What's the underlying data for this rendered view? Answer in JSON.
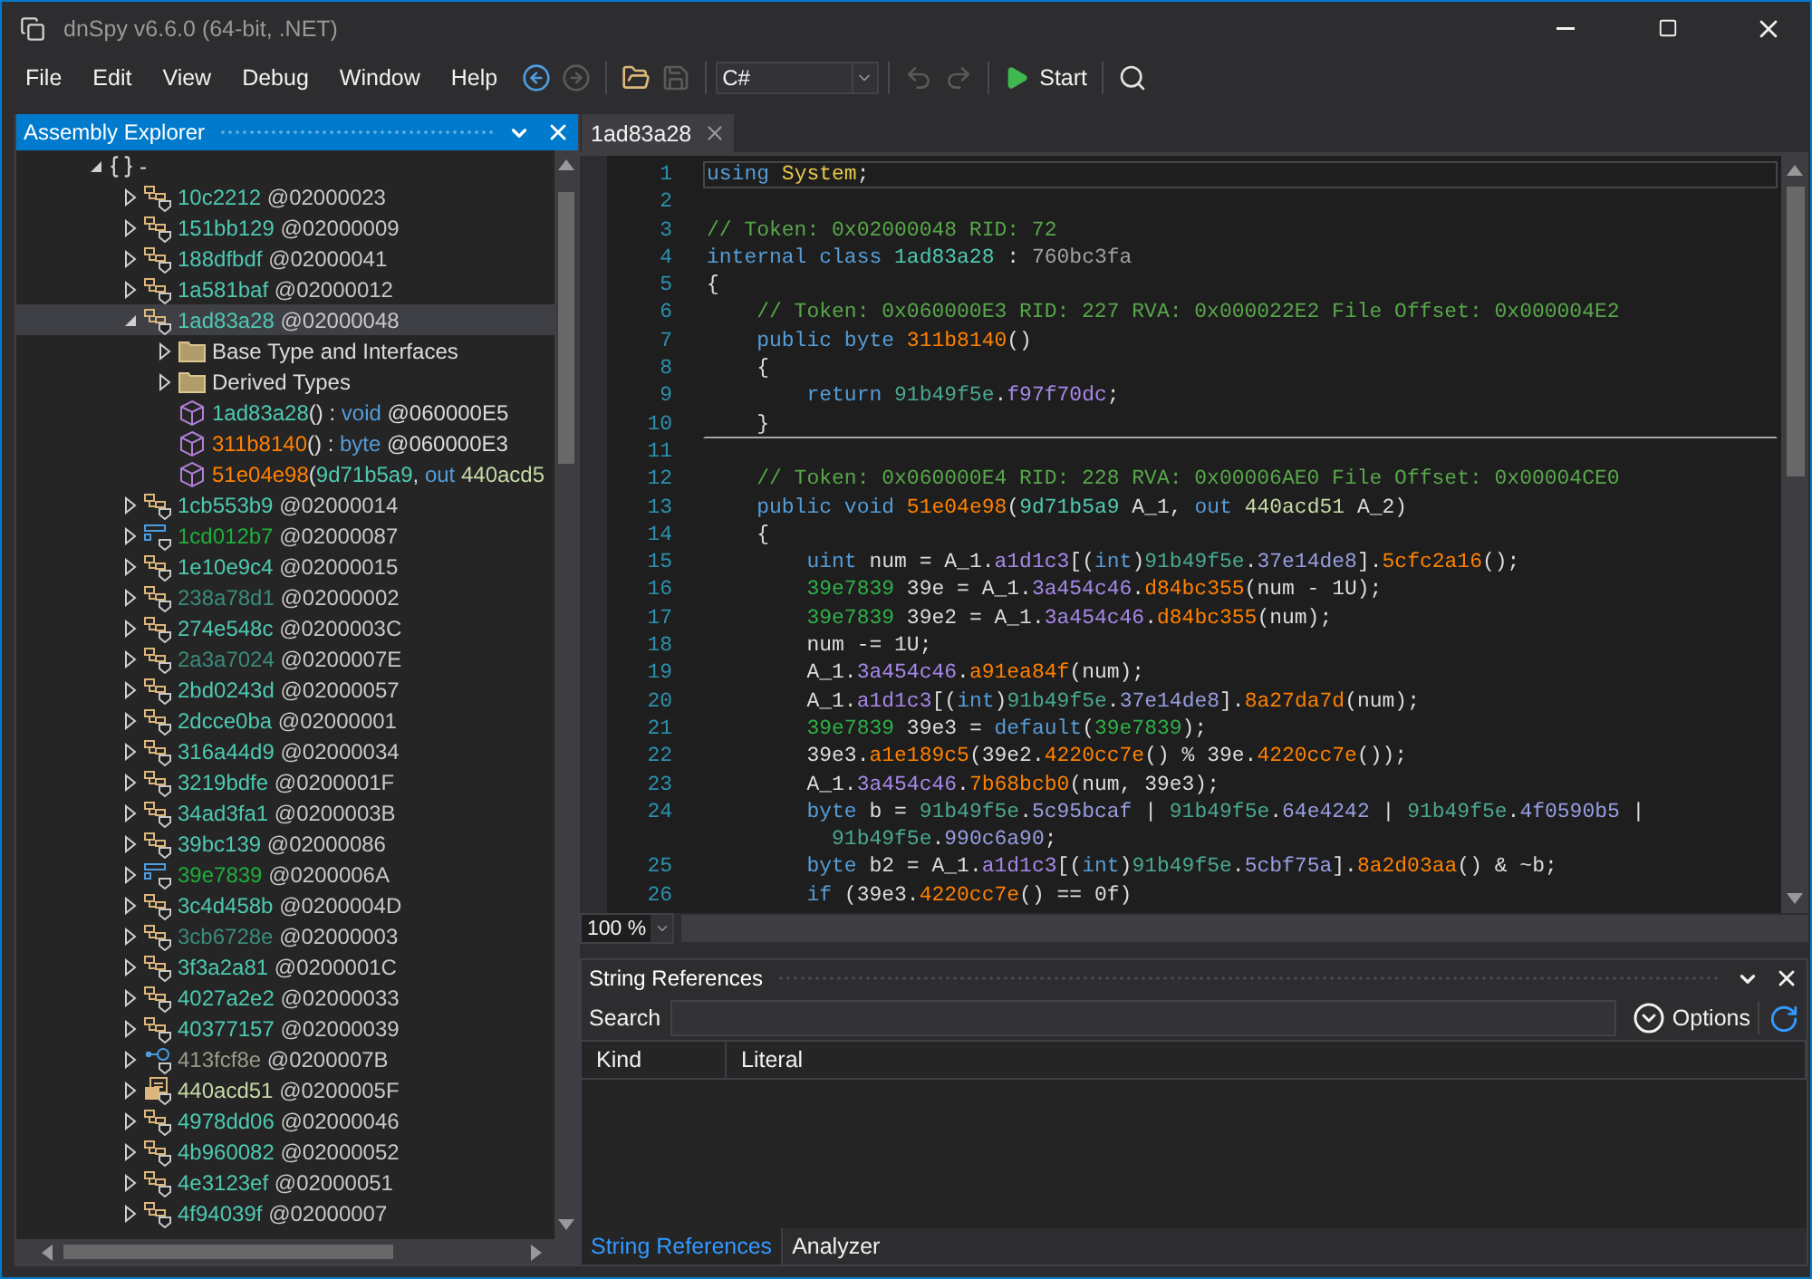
{
  "window": {
    "title": "dnSpy v6.6.0 (64-bit, .NET)"
  },
  "menu": [
    "File",
    "Edit",
    "View",
    "Debug",
    "Window",
    "Help"
  ],
  "toolbar": [
    {
      "kind": "back",
      "disabled": false
    },
    {
      "kind": "forward",
      "disabled": true
    },
    {
      "kind": "separator"
    },
    {
      "kind": "open",
      "disabled": false
    },
    {
      "kind": "save",
      "disabled": true
    },
    {
      "kind": "separator"
    },
    {
      "kind": "language",
      "value": "C#"
    },
    {
      "kind": "separator"
    },
    {
      "kind": "undo",
      "disabled": true
    },
    {
      "kind": "redo",
      "disabled": true
    },
    {
      "kind": "separator"
    },
    {
      "kind": "start",
      "label": "Start",
      "disabled": false
    },
    {
      "kind": "separator"
    },
    {
      "kind": "search",
      "disabled": false
    }
  ],
  "assembly_explorer": {
    "title": "Assembly Explorer",
    "tree": [
      {
        "kind": "namespace",
        "label": "-",
        "expanded": true,
        "selected": false,
        "children": [
          {
            "kind": "class",
            "name": "10c2212",
            "token": "@02000023",
            "dimmed": false,
            "expanded": false,
            "selected": false
          },
          {
            "kind": "class",
            "name": "151bb129",
            "token": "@02000009",
            "dimmed": false,
            "expanded": false,
            "selected": false
          },
          {
            "kind": "class",
            "name": "188dfbdf",
            "token": "@02000041",
            "dimmed": false,
            "expanded": false,
            "selected": false
          },
          {
            "kind": "class",
            "name": "1a581baf",
            "token": "@02000012",
            "dimmed": false,
            "expanded": false,
            "selected": false
          },
          {
            "kind": "class",
            "name": "1ad83a28",
            "token": "@02000048",
            "dimmed": false,
            "expanded": true,
            "selected": true,
            "children": [
              {
                "kind": "folder",
                "label": "Base Type and Interfaces",
                "expanded": false,
                "selected": false
              },
              {
                "kind": "folder",
                "label": "Derived Types",
                "expanded": false,
                "selected": false
              },
              {
                "kind": "method",
                "selected": false,
                "signature": [
                  {
                    "kind": "type",
                    "text": "1ad83a28"
                  },
                  {
                    "kind": "plain",
                    "text": "() : "
                  },
                  {
                    "kind": "keyword",
                    "text": "void"
                  },
                  {
                    "kind": "plain",
                    "text": " @060000E5"
                  }
                ]
              },
              {
                "kind": "method",
                "selected": false,
                "signature": [
                  {
                    "kind": "method",
                    "text": "311b8140"
                  },
                  {
                    "kind": "plain",
                    "text": "() : "
                  },
                  {
                    "kind": "keyword",
                    "text": "byte"
                  },
                  {
                    "kind": "plain",
                    "text": " @060000E3"
                  }
                ]
              },
              {
                "kind": "method",
                "selected": false,
                "signature": [
                  {
                    "kind": "method",
                    "text": "51e04e98"
                  },
                  {
                    "kind": "plain",
                    "text": "("
                  },
                  {
                    "kind": "type",
                    "text": "9d71b5a9"
                  },
                  {
                    "kind": "plain",
                    "text": ", "
                  },
                  {
                    "kind": "keyword",
                    "text": "out"
                  },
                  {
                    "kind": "delegate",
                    "text": " 440acd5"
                  }
                ]
              }
            ]
          },
          {
            "kind": "class",
            "name": "1cb553b9",
            "token": "@02000014",
            "dimmed": false,
            "expanded": false,
            "selected": false
          },
          {
            "kind": "struct",
            "name": "1cd012b7",
            "token": "@02000087",
            "dimmed": false,
            "expanded": false,
            "selected": false
          },
          {
            "kind": "class",
            "name": "1e10e9c4",
            "token": "@02000015",
            "dimmed": false,
            "expanded": false,
            "selected": false
          },
          {
            "kind": "class",
            "name": "238a78d1",
            "token": "@02000002",
            "dimmed": true,
            "expanded": false,
            "selected": false
          },
          {
            "kind": "class",
            "name": "274e548c",
            "token": "@0200003C",
            "dimmed": false,
            "expanded": false,
            "selected": false
          },
          {
            "kind": "class",
            "name": "2a3a7024",
            "token": "@0200007E",
            "dimmed": true,
            "expanded": false,
            "selected": false
          },
          {
            "kind": "class",
            "name": "2bd0243d",
            "token": "@02000057",
            "dimmed": false,
            "expanded": false,
            "selected": false
          },
          {
            "kind": "class",
            "name": "2dcce0ba",
            "token": "@02000001",
            "dimmed": false,
            "expanded": false,
            "selected": false
          },
          {
            "kind": "class",
            "name": "316a44d9",
            "token": "@02000034",
            "dimmed": false,
            "expanded": false,
            "selected": false
          },
          {
            "kind": "class",
            "name": "3219bdfe",
            "token": "@0200001F",
            "dimmed": false,
            "expanded": false,
            "selected": false
          },
          {
            "kind": "class",
            "name": "34ad3fa1",
            "token": "@0200003B",
            "dimmed": false,
            "expanded": false,
            "selected": false
          },
          {
            "kind": "class",
            "name": "39bc139",
            "token": "@02000086",
            "dimmed": false,
            "expanded": false,
            "selected": false
          },
          {
            "kind": "struct",
            "name": "39e7839",
            "token": "@0200006A",
            "dimmed": false,
            "expanded": false,
            "selected": false
          },
          {
            "kind": "class",
            "name": "3c4d458b",
            "token": "@0200004D",
            "dimmed": false,
            "expanded": false,
            "selected": false
          },
          {
            "kind": "class",
            "name": "3cb6728e",
            "token": "@02000003",
            "dimmed": true,
            "expanded": false,
            "selected": false
          },
          {
            "kind": "class",
            "name": "3f3a2a81",
            "token": "@0200001C",
            "dimmed": false,
            "expanded": false,
            "selected": false
          },
          {
            "kind": "class",
            "name": "4027a2e2",
            "token": "@02000033",
            "dimmed": false,
            "expanded": false,
            "selected": false
          },
          {
            "kind": "class",
            "name": "40377157",
            "token": "@02000039",
            "dimmed": false,
            "expanded": false,
            "selected": false
          },
          {
            "kind": "interface",
            "name": "413fcf8e",
            "token": "@0200007B",
            "dimmed": false,
            "expanded": false,
            "selected": false
          },
          {
            "kind": "delegate",
            "name": "440acd51",
            "token": "@0200005F",
            "dimmed": false,
            "expanded": false,
            "selected": false
          },
          {
            "kind": "class",
            "name": "4978dd06",
            "token": "@02000046",
            "dimmed": false,
            "expanded": false,
            "selected": false
          },
          {
            "kind": "class",
            "name": "4b960082",
            "token": "@02000052",
            "dimmed": false,
            "expanded": false,
            "selected": false
          },
          {
            "kind": "class",
            "name": "4e3123ef",
            "token": "@02000051",
            "dimmed": false,
            "expanded": false,
            "selected": false
          },
          {
            "kind": "class",
            "name": "4f94039f",
            "token": "@02000007",
            "dimmed": false,
            "expanded": false,
            "selected": false
          }
        ]
      }
    ]
  },
  "editor": {
    "tabs": [
      {
        "label": "1ad83a28",
        "selected": true
      }
    ],
    "lines": [
      {
        "number": "1",
        "current": true,
        "separator_below": false,
        "tokens": [
          {
            "kind": "keyword",
            "text": "using"
          },
          {
            "kind": "namespace",
            "text": " System"
          },
          {
            "kind": "plain",
            "text": ";"
          }
        ]
      },
      {
        "number": "2",
        "current": false,
        "separator_below": false
      },
      {
        "number": "3",
        "current": false,
        "separator_below": false,
        "tokens": [
          {
            "kind": "comment",
            "text": "// Token: 0x02000048 RID: 72"
          }
        ]
      },
      {
        "number": "4",
        "current": false,
        "separator_below": false,
        "tokens": [
          {
            "kind": "keyword",
            "text": "internal class"
          },
          {
            "kind": "type",
            "text": " 1ad83a28"
          },
          {
            "kind": "plain",
            "text": " : "
          },
          {
            "kind": "basetype",
            "text": "760bc3fa"
          }
        ]
      },
      {
        "number": "5",
        "current": false,
        "separator_below": false,
        "tokens": [
          {
            "kind": "plain",
            "text": "{"
          }
        ]
      },
      {
        "number": "6",
        "current": false,
        "separator_below": false,
        "tokens": [
          {
            "kind": "comment",
            "text": "    // Token: 0x060000E3 RID: 227 RVA: 0x000022E2 File Offset: 0x000004E2"
          }
        ]
      },
      {
        "number": "7",
        "current": false,
        "separator_below": false,
        "tokens": [
          {
            "kind": "keyword",
            "text": "    public byte"
          },
          {
            "kind": "method",
            "text": " 311b8140"
          },
          {
            "kind": "plain",
            "text": "()"
          }
        ]
      },
      {
        "number": "8",
        "current": false,
        "separator_below": false,
        "tokens": [
          {
            "kind": "plain",
            "text": "    {"
          }
        ]
      },
      {
        "number": "9",
        "current": false,
        "separator_below": false,
        "tokens": [
          {
            "kind": "keyword",
            "text": "        return"
          },
          {
            "kind": "enum",
            "text": " 91b49f5e"
          },
          {
            "kind": "plain",
            "text": "."
          },
          {
            "kind": "field",
            "text": "f97f70dc"
          },
          {
            "kind": "plain",
            "text": ";"
          }
        ]
      },
      {
        "number": "10",
        "current": false,
        "separator_below": true,
        "tokens": [
          {
            "kind": "plain",
            "text": "    }"
          }
        ]
      },
      {
        "number": "11",
        "current": false,
        "separator_below": false
      },
      {
        "number": "12",
        "current": false,
        "separator_below": false,
        "tokens": [
          {
            "kind": "comment",
            "text": "    // Token: 0x060000E4 RID: 228 RVA: 0x00006AE0 File Offset: 0x00004CE0"
          }
        ]
      },
      {
        "number": "13",
        "current": false,
        "separator_below": false,
        "tokens": [
          {
            "kind": "keyword",
            "text": "    public void"
          },
          {
            "kind": "method",
            "text": " 51e04e98"
          },
          {
            "kind": "plain",
            "text": "("
          },
          {
            "kind": "type",
            "text": "9d71b5a9"
          },
          {
            "kind": "plain",
            "text": " A_1, "
          },
          {
            "kind": "keyword",
            "text": "out"
          },
          {
            "kind": "delegate",
            "text": " 440acd51"
          },
          {
            "kind": "plain",
            "text": " A_2)"
          }
        ]
      },
      {
        "number": "14",
        "current": false,
        "separator_below": false,
        "tokens": [
          {
            "kind": "plain",
            "text": "    {"
          }
        ]
      },
      {
        "number": "15",
        "current": false,
        "separator_below": false,
        "tokens": [
          {
            "kind": "keyword",
            "text": "        uint"
          },
          {
            "kind": "plain",
            "text": " num = A_1."
          },
          {
            "kind": "field",
            "text": "a1d1c3"
          },
          {
            "kind": "plain",
            "text": "[("
          },
          {
            "kind": "keyword",
            "text": "int"
          },
          {
            "kind": "plain",
            "text": ")"
          },
          {
            "kind": "enum",
            "text": "91b49f5e"
          },
          {
            "kind": "plain",
            "text": "."
          },
          {
            "kind": "constant",
            "text": "37e14de8"
          },
          {
            "kind": "plain",
            "text": "]."
          },
          {
            "kind": "method",
            "text": "5cfc2a16"
          },
          {
            "kind": "plain",
            "text": "();"
          }
        ]
      },
      {
        "number": "16",
        "current": false,
        "separator_below": false,
        "tokens": [
          {
            "kind": "struct",
            "text": "        39e7839"
          },
          {
            "kind": "plain",
            "text": " 39e = A_1."
          },
          {
            "kind": "field",
            "text": "3a454c46"
          },
          {
            "kind": "plain",
            "text": "."
          },
          {
            "kind": "method",
            "text": "d84bc355"
          },
          {
            "kind": "plain",
            "text": "(num - 1U);"
          }
        ]
      },
      {
        "number": "17",
        "current": false,
        "separator_below": false,
        "tokens": [
          {
            "kind": "struct",
            "text": "        39e7839"
          },
          {
            "kind": "plain",
            "text": " 39e2 = A_1."
          },
          {
            "kind": "field",
            "text": "3a454c46"
          },
          {
            "kind": "plain",
            "text": "."
          },
          {
            "kind": "method",
            "text": "d84bc355"
          },
          {
            "kind": "plain",
            "text": "(num);"
          }
        ]
      },
      {
        "number": "18",
        "current": false,
        "separator_below": false,
        "tokens": [
          {
            "kind": "plain",
            "text": "        num -= 1U;"
          }
        ]
      },
      {
        "number": "19",
        "current": false,
        "separator_below": false,
        "tokens": [
          {
            "kind": "plain",
            "text": "        A_1."
          },
          {
            "kind": "field",
            "text": "3a454c46"
          },
          {
            "kind": "plain",
            "text": "."
          },
          {
            "kind": "method",
            "text": "a91ea84f"
          },
          {
            "kind": "plain",
            "text": "(num);"
          }
        ]
      },
      {
        "number": "20",
        "current": false,
        "separator_below": false,
        "tokens": [
          {
            "kind": "plain",
            "text": "        A_1."
          },
          {
            "kind": "field",
            "text": "a1d1c3"
          },
          {
            "kind": "plain",
            "text": "[("
          },
          {
            "kind": "keyword",
            "text": "int"
          },
          {
            "kind": "plain",
            "text": ")"
          },
          {
            "kind": "enum",
            "text": "91b49f5e"
          },
          {
            "kind": "plain",
            "text": "."
          },
          {
            "kind": "constant",
            "text": "37e14de8"
          },
          {
            "kind": "plain",
            "text": "]."
          },
          {
            "kind": "method",
            "text": "8a27da7d"
          },
          {
            "kind": "plain",
            "text": "(num);"
          }
        ]
      },
      {
        "number": "21",
        "current": false,
        "separator_below": false,
        "tokens": [
          {
            "kind": "struct",
            "text": "        39e7839"
          },
          {
            "kind": "plain",
            "text": " 39e3 = "
          },
          {
            "kind": "keyword",
            "text": "default"
          },
          {
            "kind": "plain",
            "text": "("
          },
          {
            "kind": "struct",
            "text": "39e7839"
          },
          {
            "kind": "plain",
            "text": ");"
          }
        ]
      },
      {
        "number": "22",
        "current": false,
        "separator_below": false,
        "tokens": [
          {
            "kind": "plain",
            "text": "        39e3."
          },
          {
            "kind": "method",
            "text": "a1e189c5"
          },
          {
            "kind": "plain",
            "text": "(39e2."
          },
          {
            "kind": "method",
            "text": "4220cc7e"
          },
          {
            "kind": "plain",
            "text": "() % 39e."
          },
          {
            "kind": "method",
            "text": "4220cc7e"
          },
          {
            "kind": "plain",
            "text": "());"
          }
        ]
      },
      {
        "number": "23",
        "current": false,
        "separator_below": false,
        "tokens": [
          {
            "kind": "plain",
            "text": "        A_1."
          },
          {
            "kind": "field",
            "text": "3a454c46"
          },
          {
            "kind": "plain",
            "text": "."
          },
          {
            "kind": "method",
            "text": "7b68bcb0"
          },
          {
            "kind": "plain",
            "text": "(num, 39e3);"
          }
        ]
      },
      {
        "number": "24",
        "current": false,
        "separator_below": false,
        "tokens": [
          {
            "kind": "keyword",
            "text": "        byte"
          },
          {
            "kind": "plain",
            "text": " b = "
          },
          {
            "kind": "enum",
            "text": "91b49f5e"
          },
          {
            "kind": "plain",
            "text": "."
          },
          {
            "kind": "constant",
            "text": "5c95bcaf"
          },
          {
            "kind": "plain",
            "text": " | "
          },
          {
            "kind": "enum",
            "text": "91b49f5e"
          },
          {
            "kind": "plain",
            "text": "."
          },
          {
            "kind": "constant",
            "text": "64e4242"
          },
          {
            "kind": "plain",
            "text": " | "
          },
          {
            "kind": "enum",
            "text": "91b49f5e"
          },
          {
            "kind": "plain",
            "text": "."
          },
          {
            "kind": "constant",
            "text": "4f0590b5"
          },
          {
            "kind": "plain",
            "text": " |"
          }
        ],
        "continuation": [
          {
            "kind": "enum",
            "text": "          91b49f5e"
          },
          {
            "kind": "plain",
            "text": "."
          },
          {
            "kind": "constant",
            "text": "990c6a90"
          },
          {
            "kind": "plain",
            "text": ";"
          }
        ]
      },
      {
        "number": "25",
        "current": false,
        "separator_below": false,
        "tokens": [
          {
            "kind": "keyword",
            "text": "        byte"
          },
          {
            "kind": "plain",
            "text": " b2 = A_1."
          },
          {
            "kind": "field",
            "text": "a1d1c3"
          },
          {
            "kind": "plain",
            "text": "[("
          },
          {
            "kind": "keyword",
            "text": "int"
          },
          {
            "kind": "plain",
            "text": ")"
          },
          {
            "kind": "enum",
            "text": "91b49f5e"
          },
          {
            "kind": "plain",
            "text": "."
          },
          {
            "kind": "constant",
            "text": "5cbf75a"
          },
          {
            "kind": "plain",
            "text": "]."
          },
          {
            "kind": "method",
            "text": "8a2d03aa"
          },
          {
            "kind": "plain",
            "text": "() & ~b;"
          }
        ]
      },
      {
        "number": "26",
        "current": false,
        "separator_below": false,
        "tokens": [
          {
            "kind": "keyword",
            "text": "        if"
          },
          {
            "kind": "plain",
            "text": " (39e3."
          },
          {
            "kind": "method",
            "text": "4220cc7e"
          },
          {
            "kind": "plain",
            "text": "() == 0f)"
          }
        ]
      }
    ],
    "zoom": "100 %"
  },
  "string_references": {
    "title": "String References",
    "search_label": "Search",
    "options": "Options",
    "columns": [
      "Kind",
      "Literal"
    ]
  },
  "bottom_tabs": [
    {
      "label": "String References",
      "selected": true
    },
    {
      "label": "Analyzer",
      "selected": false
    }
  ]
}
